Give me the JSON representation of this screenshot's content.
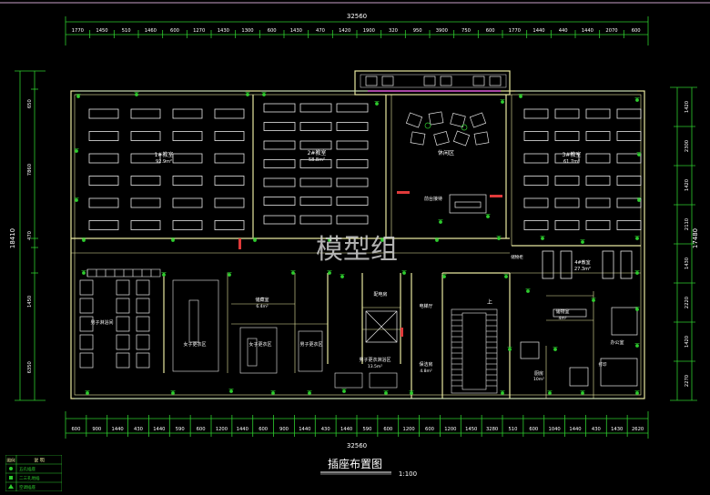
{
  "drawing": {
    "title": "插座布置图",
    "scale": "1:100",
    "watermark": "模型组"
  },
  "dimensions": {
    "top_total": "32560",
    "bottom_total": "32560",
    "top_segments": [
      "1770",
      "1450",
      "510",
      "1460",
      "600",
      "1270",
      "1430",
      "1300",
      "600",
      "1430",
      "470",
      "1420",
      "1900",
      "320",
      "950",
      "3900",
      "750",
      "600",
      "1770",
      "1440",
      "440",
      "1440",
      "2070",
      "600"
    ],
    "bottom_segments": [
      "600",
      "900",
      "1440",
      "430",
      "1440",
      "590",
      "600",
      "1200",
      "1440",
      "600",
      "900",
      "1440",
      "430",
      "1440",
      "590",
      "600",
      "1200",
      "600",
      "1200",
      "1450",
      "3280",
      "510",
      "600",
      "1040",
      "1440",
      "430",
      "1430",
      "2620"
    ],
    "left_total": "18410",
    "left_segments": [
      "650",
      "7860",
      "470",
      "1450",
      "6350"
    ],
    "right_total": "17480",
    "right_segments": [
      "1420",
      "2300",
      "1420",
      "2110",
      "1430",
      "2220",
      "1420",
      "2270"
    ]
  },
  "rooms": {
    "training1": "1#教室",
    "training1_area": "92.9m²",
    "training2": "2#教室",
    "training2_area": "58.8m²",
    "training3": "3#教室",
    "training3_area": "61.7m²",
    "lounge": "休闲区",
    "front_desk": "前台接待",
    "classroom4": "4#教室",
    "classroom4_area": "27.3m²",
    "male_restroom": "男子淋浴间",
    "female_changing": "女子更衣区",
    "male_changing": "女子更衣区",
    "changing3": "男子更衣区",
    "storage": "储藏室",
    "storage_area": "6.4m²",
    "power_room": "配电房",
    "elevator_hall": "电梯厅",
    "shower_area": "男子更衣淋浴区",
    "shower_area_size": "13.5m²",
    "janitor": "保洁房",
    "janitor_area": "4.8m²",
    "stair_up": "上",
    "storage2": "储物室",
    "storage2_area": "4m²",
    "office": "办公室",
    "kitchen": "厨房",
    "kitchen_area": "10m²",
    "corridor_label": "储物柜",
    "print": "打印"
  },
  "legend": {
    "header_symbol": "图例",
    "header_desc": "说 明",
    "items": [
      "五孔插座",
      "二三孔地插",
      "空调插座"
    ]
  },
  "colors": {
    "background": "#000000",
    "dimension_green": "#2ecc2e",
    "wall_yellow": "#e8e8a0",
    "furniture_white": "#e8e8e8",
    "text_white": "#ffffff",
    "accent_red": "#e03a3a",
    "watermark": "#cfcfcf",
    "magenta_line": "#d04fd0"
  }
}
